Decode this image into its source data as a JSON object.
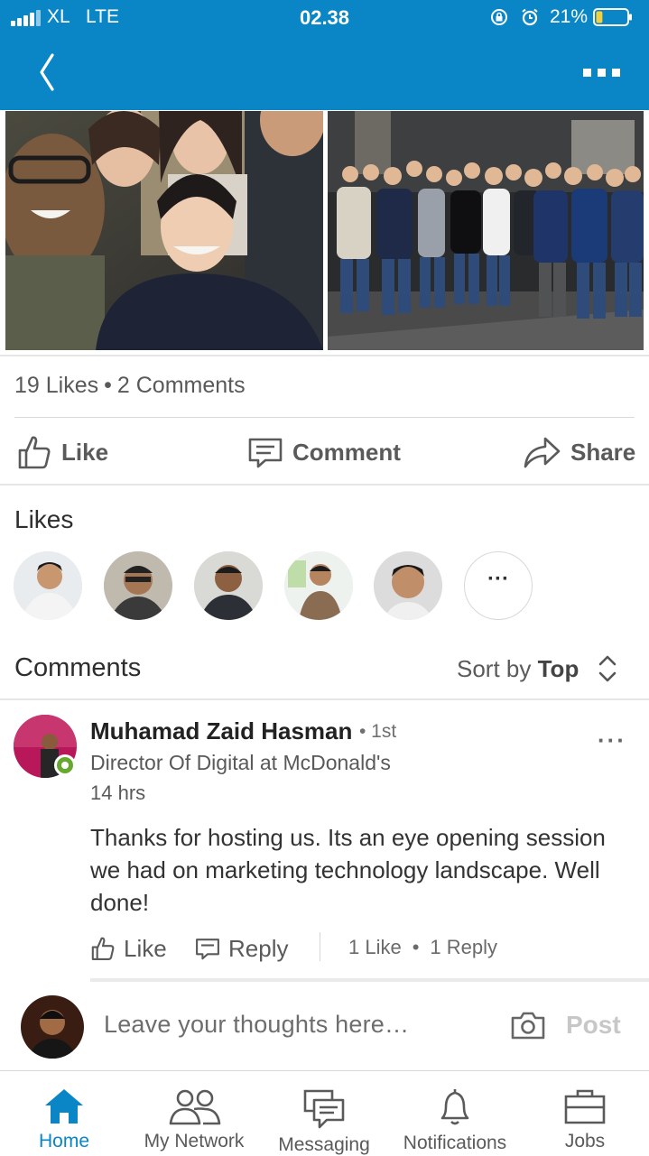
{
  "status_bar": {
    "carrier": "XL",
    "network": "LTE",
    "time": "02.38",
    "battery_percent": "21%",
    "battery_level": 0.21
  },
  "post": {
    "likes_count": "19 Likes",
    "comments_count": "2 Comments",
    "separator": "•"
  },
  "actions": {
    "like": "Like",
    "comment": "Comment",
    "share": "Share"
  },
  "likes_section": {
    "title": "Likes",
    "more": "···"
  },
  "comments_section": {
    "title": "Comments",
    "sort_label": "Sort by",
    "sort_value": "Top"
  },
  "comment": {
    "author": "Muhamad Zaid Hasman",
    "degree": "• 1st",
    "headline": "Director Of Digital at McDonald's",
    "time": "14 hrs",
    "text": "Thanks for hosting us. Its an eye opening session we had on marketing technology landscape. Well done!",
    "like_label": "Like",
    "reply_label": "Reply",
    "like_count": "1 Like",
    "reply_count": "1 Reply",
    "separator": "•",
    "more": "···"
  },
  "composer": {
    "placeholder": "Leave your thoughts here…",
    "post_label": "Post"
  },
  "bottom_nav": {
    "home": "Home",
    "network": "My Network",
    "messaging": "Messaging",
    "notifications": "Notifications",
    "jobs": "Jobs"
  },
  "colors": {
    "brand": "#0a86c7",
    "online": "#69a82f"
  }
}
